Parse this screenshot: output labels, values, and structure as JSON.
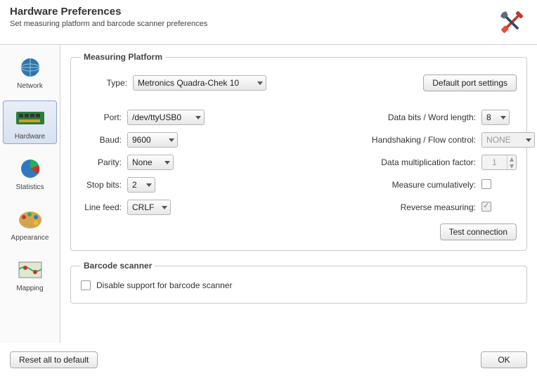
{
  "header": {
    "title": "Hardware Preferences",
    "subtitle": "Set measuring platform and barcode scanner preferences"
  },
  "sidebar": {
    "items": [
      {
        "label": "Network"
      },
      {
        "label": "Hardware"
      },
      {
        "label": "Statistics"
      },
      {
        "label": "Appearance"
      },
      {
        "label": "Mapping"
      }
    ]
  },
  "platform": {
    "legend": "Measuring Platform",
    "type_label": "Type:",
    "type_value": "Metronics Quadra-Chek 10",
    "default_port_btn": "Default port settings",
    "port_label": "Port:",
    "port_value": "/dev/ttyUSB0",
    "baud_label": "Baud:",
    "baud_value": "9600",
    "parity_label": "Parity:",
    "parity_value": "None",
    "stopbits_label": "Stop bits:",
    "stopbits_value": "2",
    "linefeed_label": "Line feed:",
    "linefeed_value": "CRLF",
    "databits_label": "Data bits / Word length:",
    "databits_value": "8",
    "handshake_label": "Handshaking / Flow control:",
    "handshake_value": "NONE",
    "mult_label": "Data multiplication factor:",
    "mult_value": "1",
    "cumulative_label": "Measure cumulatively:",
    "reverse_label": "Reverse measuring:",
    "test_btn": "Test connection"
  },
  "barcode": {
    "legend": "Barcode scanner",
    "disable_label": "Disable support for barcode scanner"
  },
  "footer": {
    "reset": "Reset all to default",
    "ok": "OK"
  }
}
